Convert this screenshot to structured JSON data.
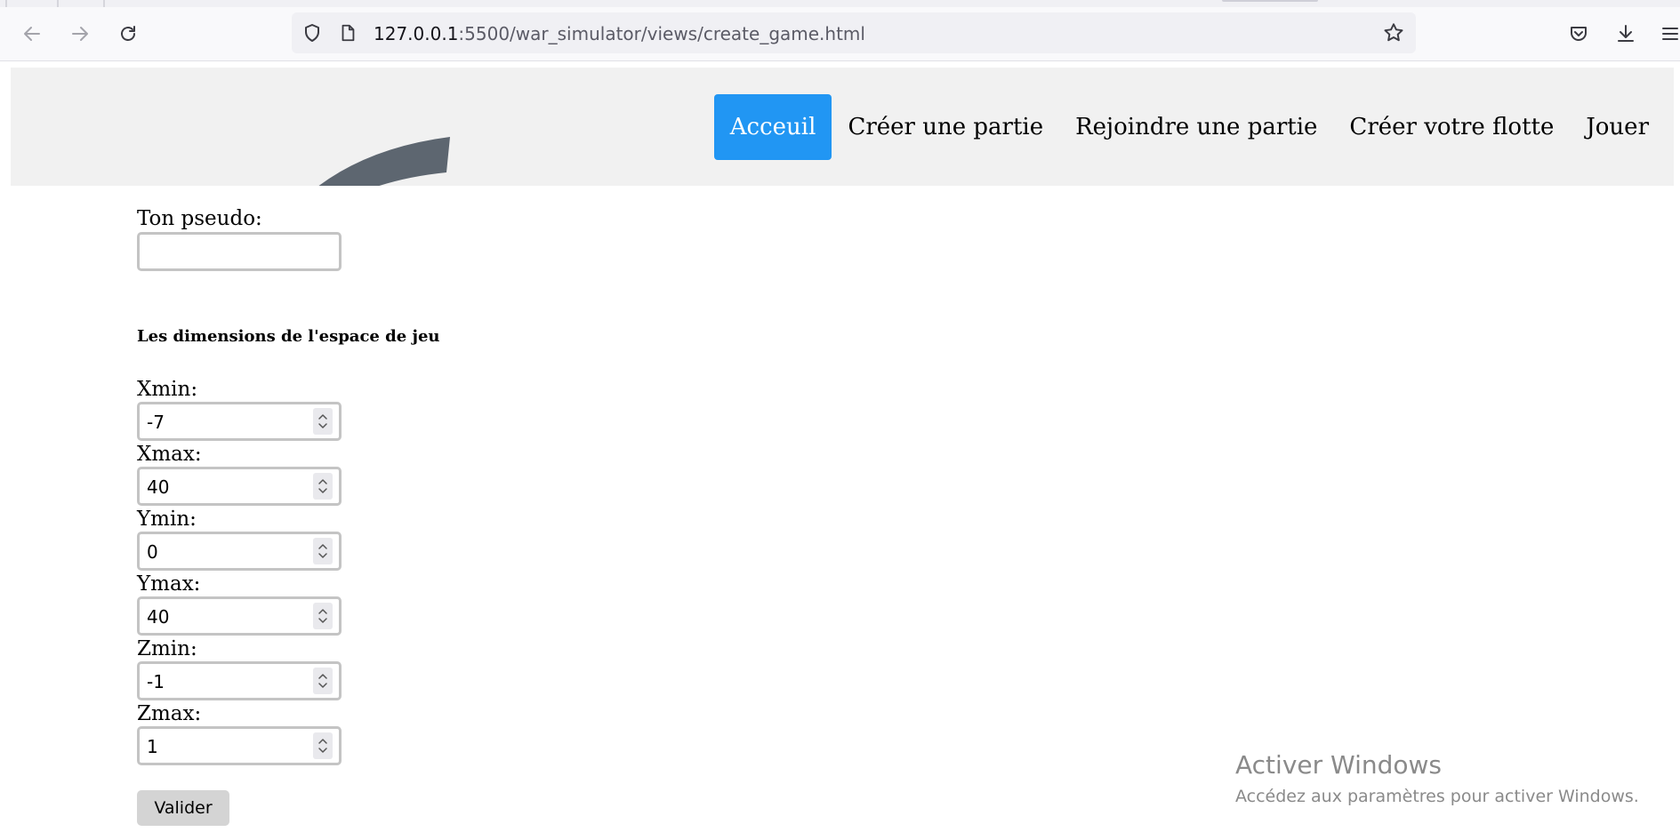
{
  "browser": {
    "url_host": "127.0.0.1",
    "url_rest": ":5500/war_simulator/views/create_game.html",
    "icons": [
      "back-arrow-icon",
      "forward-arrow-icon",
      "reload-icon",
      "shield-icon",
      "page-icon",
      "bookmark-star-icon",
      "pocket-icon",
      "download-icon",
      "menu-icon"
    ]
  },
  "nav": {
    "items": [
      "Acceuil",
      "Créer une partie",
      "Rejoindre une partie",
      "Créer votre flotte",
      "Jouer"
    ],
    "active_color": "#2196f3"
  },
  "form": {
    "pseudo_label": "Ton pseudo:",
    "pseudo_value": "",
    "section_title": "Les dimensions de l'espace de jeu",
    "fields": [
      {
        "label": "Xmin:",
        "value": "-7"
      },
      {
        "label": "Xmax:",
        "value": "40"
      },
      {
        "label": "Ymin:",
        "value": "0"
      },
      {
        "label": "Ymax:",
        "value": "40"
      },
      {
        "label": "Zmin:",
        "value": "-1"
      },
      {
        "label": "Zmax:",
        "value": "1"
      }
    ],
    "submit_label": "Valider"
  },
  "watermark": {
    "title": "Activer Windows",
    "subtitle": "Accédez aux paramètres pour activer Windows."
  }
}
